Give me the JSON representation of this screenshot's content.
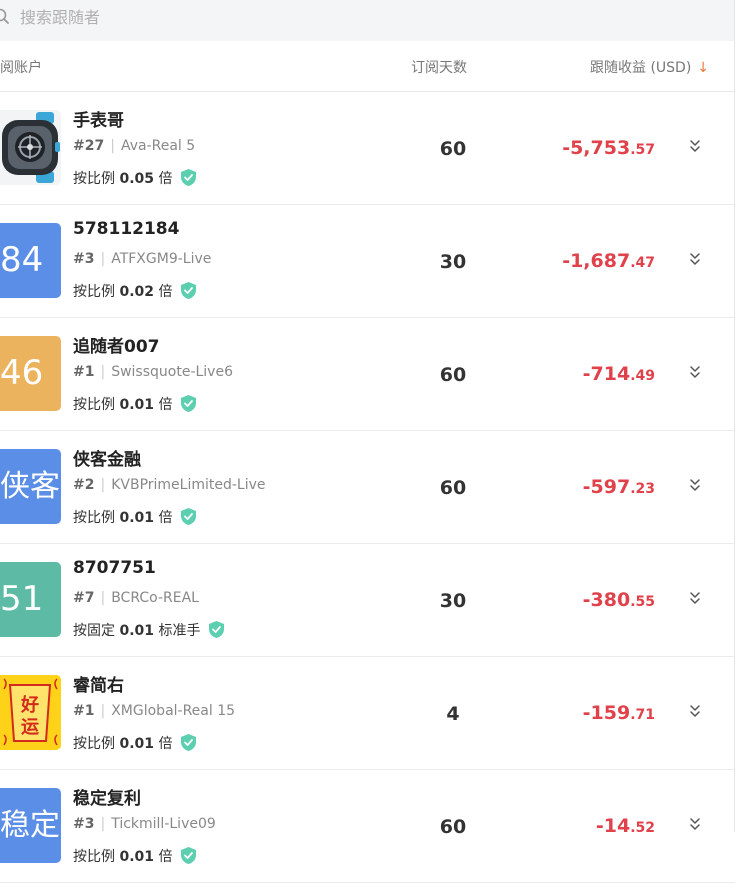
{
  "search": {
    "placeholder": "搜索跟随者"
  },
  "header": {
    "account": "阅账户",
    "days": "订阅天数",
    "profit": "跟随收益 (USD)",
    "sort_icon": "↓"
  },
  "rows": [
    {
      "name": "手表哥",
      "rank": "#27",
      "broker": "Ava-Real 5",
      "ratio_prefix": "按比例",
      "ratio_value": "0.05",
      "ratio_suffix": "倍",
      "days": "60",
      "profit_int": "-5,753",
      "profit_dec": ".57",
      "avatar_type": "watch-image",
      "avatar_text": ""
    },
    {
      "name": "578112184",
      "rank": "#3",
      "broker": "ATFXGM9-Live",
      "ratio_prefix": "按比例",
      "ratio_value": "0.02",
      "ratio_suffix": "倍",
      "days": "30",
      "profit_int": "-1,687",
      "profit_dec": ".47",
      "avatar_text": "84",
      "avatar_color": "#5b8ee6"
    },
    {
      "name": "追随者007",
      "rank": "#1",
      "broker": "Swissquote-Live6",
      "ratio_prefix": "按比例",
      "ratio_value": "0.01",
      "ratio_suffix": "倍",
      "days": "60",
      "profit_int": "-714",
      "profit_dec": ".49",
      "avatar_text": "46",
      "avatar_color": "#ecb35e"
    },
    {
      "name": "侠客金融",
      "rank": "#2",
      "broker": "KVBPrimeLimited-Live",
      "ratio_prefix": "按比例",
      "ratio_value": "0.01",
      "ratio_suffix": "倍",
      "days": "60",
      "profit_int": "-597",
      "profit_dec": ".23",
      "avatar_text": "侠客",
      "avatar_color": "#5b8ee6"
    },
    {
      "name": "8707751",
      "rank": "#7",
      "broker": "BCRCo-REAL",
      "ratio_prefix": "按固定",
      "ratio_value": "0.01",
      "ratio_suffix": "标准手",
      "days": "30",
      "profit_int": "-380",
      "profit_dec": ".55",
      "avatar_text": "51",
      "avatar_color": "#5dbaa4"
    },
    {
      "name": "睿简右",
      "rank": "#1",
      "broker": "XMGlobal-Real 15",
      "ratio_prefix": "按比例",
      "ratio_value": "0.01",
      "ratio_suffix": "倍",
      "days": "4",
      "profit_int": "-159",
      "profit_dec": ".71",
      "avatar_type": "luck-image",
      "avatar_text": "好运"
    },
    {
      "name": "稳定复利",
      "rank": "#3",
      "broker": "Tickmill-Live09",
      "ratio_prefix": "按比例",
      "ratio_value": "0.01",
      "ratio_suffix": "倍",
      "days": "60",
      "profit_int": "-14",
      "profit_dec": ".52",
      "avatar_text": "稳定",
      "avatar_color": "#5b8ee6"
    }
  ],
  "colors": {
    "profit_negative": "#e0414a",
    "shield": "#5ccfb0",
    "sort_accent": "#f0793a"
  }
}
